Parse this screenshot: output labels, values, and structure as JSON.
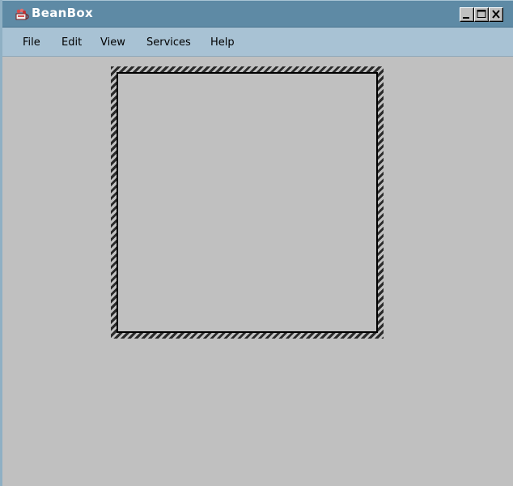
{
  "window": {
    "title": "BeanBox",
    "app_icon": "beanbox-cup-icon",
    "controls": {
      "minimize": "minimize-icon",
      "maximize": "maximize-icon",
      "close": "close-icon"
    }
  },
  "menubar": {
    "items": [
      {
        "label": "File"
      },
      {
        "label": "Edit"
      },
      {
        "label": "View"
      },
      {
        "label": "Services"
      },
      {
        "label": "Help"
      }
    ]
  },
  "colors": {
    "titlebar": "#5e8aa5",
    "menubar": "#a8c2d4",
    "canvas": "#c0c0c0",
    "selection_hatch": "#2b2b2b"
  }
}
